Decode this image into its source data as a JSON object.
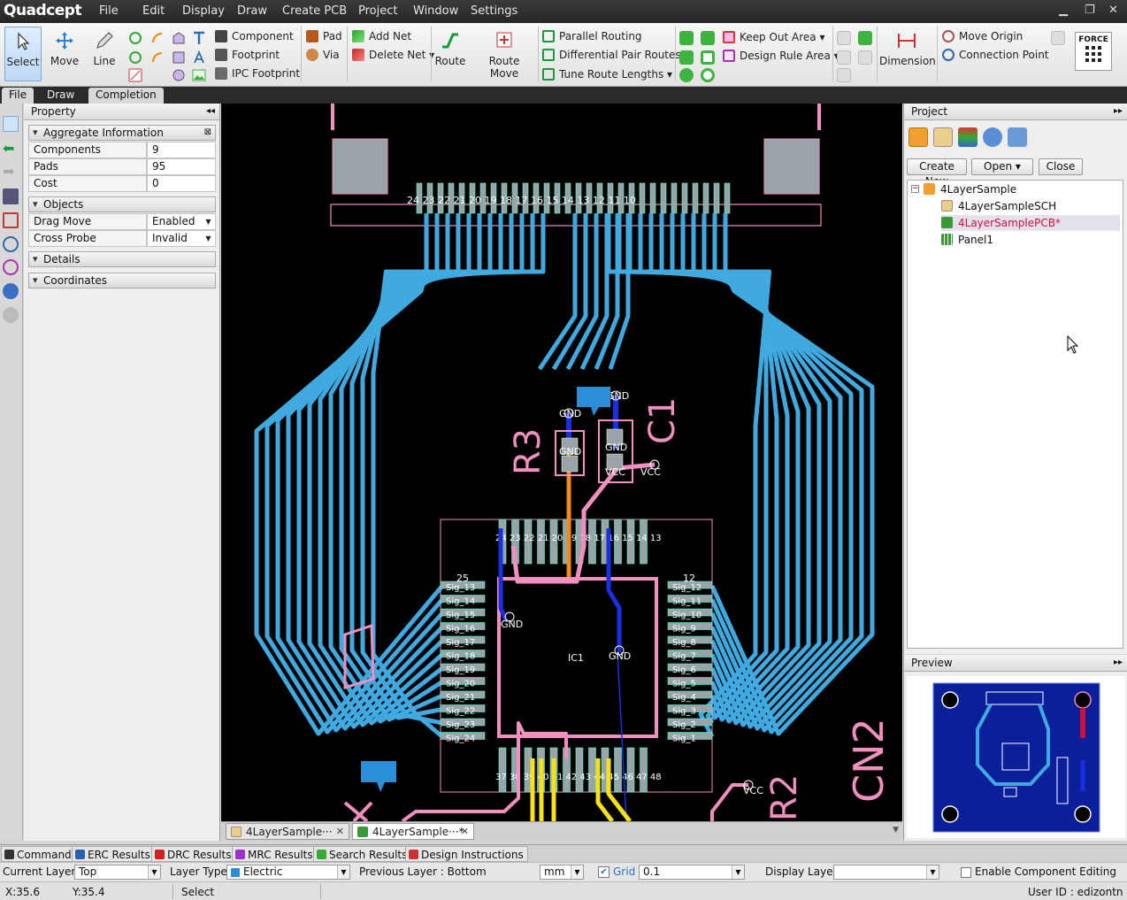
{
  "app": {
    "brand": "Quadcept",
    "menu": [
      "File",
      "Edit",
      "Display",
      "Draw",
      "Create PCB",
      "Project",
      "Window",
      "Settings"
    ]
  },
  "ribbon": {
    "select": "Select",
    "move": "Move",
    "line": "Line",
    "component": "Component",
    "footprint": "Footprint",
    "ipc_footprint": "IPC Footprint",
    "pad": "Pad",
    "via": "Via",
    "add_net": "Add Net",
    "delete_net": "Delete Net",
    "route": "Route",
    "route_move": "Route Move",
    "parallel_routing": "Parallel Routing",
    "differential_pair_routes": "Differential Pair Routes",
    "tune_route_lengths": "Tune Route Lengths",
    "keep_out_area": "Keep Out Area",
    "design_rule_area": "Design Rule Area",
    "dimension": "Dimension",
    "move_origin": "Move Origin",
    "connection_point": "Connection Point",
    "force": "FORCE"
  },
  "subtabs": [
    "File",
    "Draw",
    "Completion"
  ],
  "property": {
    "title": "Property",
    "aggregate_title": "Aggregate Information",
    "aggregate": [
      {
        "key": "Components",
        "value": "9"
      },
      {
        "key": "Pads",
        "value": "95"
      },
      {
        "key": "Cost",
        "value": "0"
      }
    ],
    "objects_title": "Objects",
    "objects": [
      {
        "key": "Drag Move",
        "value": "Enabled"
      },
      {
        "key": "Cross Probe",
        "value": "Invalid"
      }
    ],
    "details_title": "Details",
    "coordinates_title": "Coordinates"
  },
  "canvas": {
    "ic_label": "IC1",
    "r3": "R3",
    "c1": "C1",
    "cn2": "CN2",
    "r2": "R2",
    "gnd": "GND",
    "vcc": "VCC",
    "left_pin_labels": [
      "Sig_13",
      "Sig_14",
      "Sig_15",
      "Sig_16",
      "Sig_17",
      "Sig_18",
      "Sig_19",
      "Sig_20",
      "Sig_21",
      "Sig_22",
      "Sig_23",
      "Sig_24"
    ],
    "right_pin_labels": [
      "Sig_12",
      "Sig_11",
      "Sig_10",
      "Sig_9",
      "Sig_8",
      "Sig_7",
      "Sig_6",
      "Sig_5",
      "Sig_4",
      "Sig_3",
      "Sig_2",
      "Sig_1"
    ],
    "pin25": "25",
    "pin12": "12",
    "top_pins": "24 23 22 21 20 19 18 17 16 15 14 13",
    "bottom_pins": "37 38 39 40 41 42 43 44 45 46 47 48",
    "conn_pins": "24 23 22 21 20 19 18 17 16 15 14 13 12 11 10"
  },
  "doc_tabs": [
    {
      "label": "4LayerSample···",
      "active": false
    },
    {
      "label": "4LayerSample···*",
      "active": true
    }
  ],
  "project": {
    "title": "Project",
    "buttons": {
      "create_new": "Create New",
      "open": "Open",
      "close": "Close"
    },
    "tree": [
      {
        "label": "4LayerSample",
        "level": 0,
        "type": "prj"
      },
      {
        "label": "4LayerSampleSCH",
        "level": 1,
        "type": "sch"
      },
      {
        "label": "4LayerSamplePCB*",
        "level": 1,
        "type": "pcb",
        "selected": true
      },
      {
        "label": "Panel1",
        "level": 1,
        "type": "panel"
      }
    ]
  },
  "preview": {
    "title": "Preview"
  },
  "results_tabs": [
    "Command",
    "ERC Results",
    "DRC Results",
    "MRC Results",
    "Search Results",
    "Design Instructions"
  ],
  "layerbar": {
    "current_layer_label": "Current Layer",
    "current_layer": "Top",
    "layer_type_label": "Layer Type",
    "layer_type": "Electric",
    "previous_layer": "Previous Layer : Bottom",
    "unit": "mm",
    "grid_label": "Grid",
    "grid_value": "0.1",
    "display_layer_label": "Display Layer",
    "display_layer": "",
    "enable_component_editing": "Enable Component Editing"
  },
  "status": {
    "x": "X:35.6",
    "y": "Y:35.4",
    "mode": "Select",
    "user": "User ID : edizontn"
  },
  "colors": {
    "trace_top": "#3fa9e0",
    "silk": "#f08fc0",
    "trace_orange": "#f08a1e",
    "trace_blue": "#1a2fe0",
    "trace_yellow": "#f5e21a",
    "accent_red": "#e0103a"
  }
}
